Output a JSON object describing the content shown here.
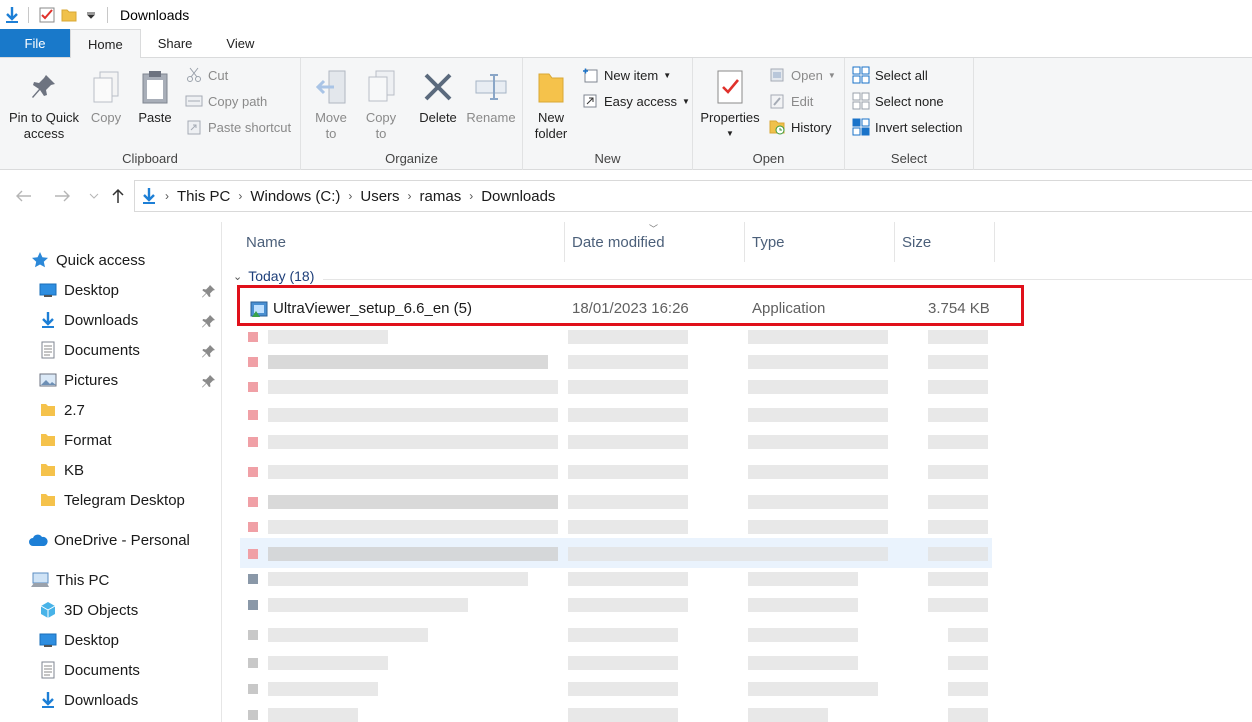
{
  "window": {
    "title": "Downloads"
  },
  "tabs": [
    "File",
    "Home",
    "Share",
    "View"
  ],
  "ribbon": {
    "clipboard": {
      "label": "Clipboard",
      "pin": "Pin to Quick\naccess",
      "copy": "Copy",
      "paste": "Paste",
      "cut": "Cut",
      "copy_path": "Copy path",
      "paste_shortcut": "Paste shortcut"
    },
    "organize": {
      "label": "Organize",
      "move_to": "Move\nto",
      "copy_to": "Copy\nto",
      "delete": "Delete",
      "rename": "Rename"
    },
    "new": {
      "label": "New",
      "new_folder": "New\nfolder",
      "new_item": "New item",
      "easy_access": "Easy access"
    },
    "open": {
      "label": "Open",
      "properties": "Properties",
      "open": "Open",
      "edit": "Edit",
      "history": "History"
    },
    "select": {
      "label": "Select",
      "select_all": "Select all",
      "select_none": "Select none",
      "invert": "Invert selection"
    }
  },
  "breadcrumb": [
    "This PC",
    "Windows (C:)",
    "Users",
    "ramas",
    "Downloads"
  ],
  "nav": {
    "quick_access": "Quick access",
    "quick_items": [
      "Desktop",
      "Downloads",
      "Documents",
      "Pictures",
      "2.7",
      "Format",
      "KB",
      "Telegram Desktop"
    ],
    "onedrive": "OneDrive - Personal",
    "this_pc": "This PC",
    "pc_items": [
      "3D Objects",
      "Desktop",
      "Documents",
      "Downloads"
    ]
  },
  "columns": {
    "name": "Name",
    "date": "Date modified",
    "type": "Type",
    "size": "Size"
  },
  "group": "Today (18)",
  "file": {
    "name": "UltraViewer_setup_6.6_en (5)",
    "date": "18/01/2023 16:26",
    "type": "Application",
    "size": "3.754 KB"
  },
  "colors": {
    "accent": "#1979ca",
    "highlight": "#e0101a",
    "folder": "#f0c14b"
  }
}
